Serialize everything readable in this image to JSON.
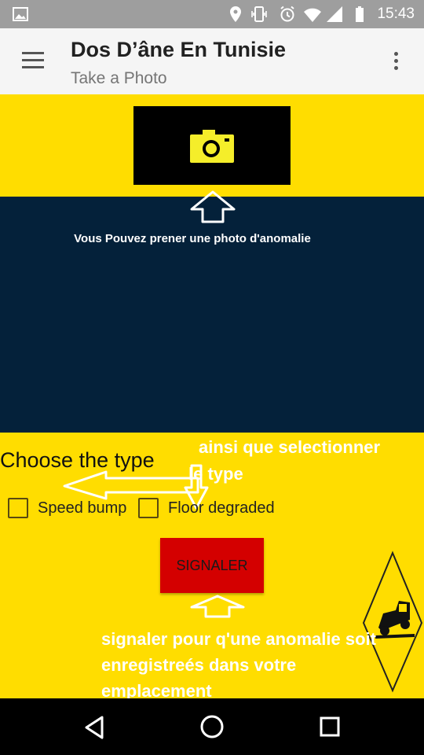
{
  "status_bar": {
    "time": "15:43"
  },
  "app_bar": {
    "title": "Dos D’âne En Tunisie",
    "subtitle": "Take a Photo"
  },
  "photo": {
    "hint": "Vous Pouvez prener une photo d'anomalie"
  },
  "type_section": {
    "title": "Choose the type",
    "hint_line1": "ainsi que selectionner",
    "hint_line2": "le type",
    "options": [
      {
        "label": "Speed bump",
        "checked": false
      },
      {
        "label": "Floor degraded",
        "checked": false
      }
    ]
  },
  "signaler": {
    "label": "SIGNALER",
    "hint_line1": "signaler pour q'une anomalie soit",
    "hint_line2": "enregistreés dans votre",
    "hint_line3": "emplacement"
  },
  "colors": {
    "accent_yellow": "#ffdd00",
    "preview_dark": "#04213a",
    "signaler_red": "#d40000",
    "camera_yellow": "#f5ee2a"
  }
}
